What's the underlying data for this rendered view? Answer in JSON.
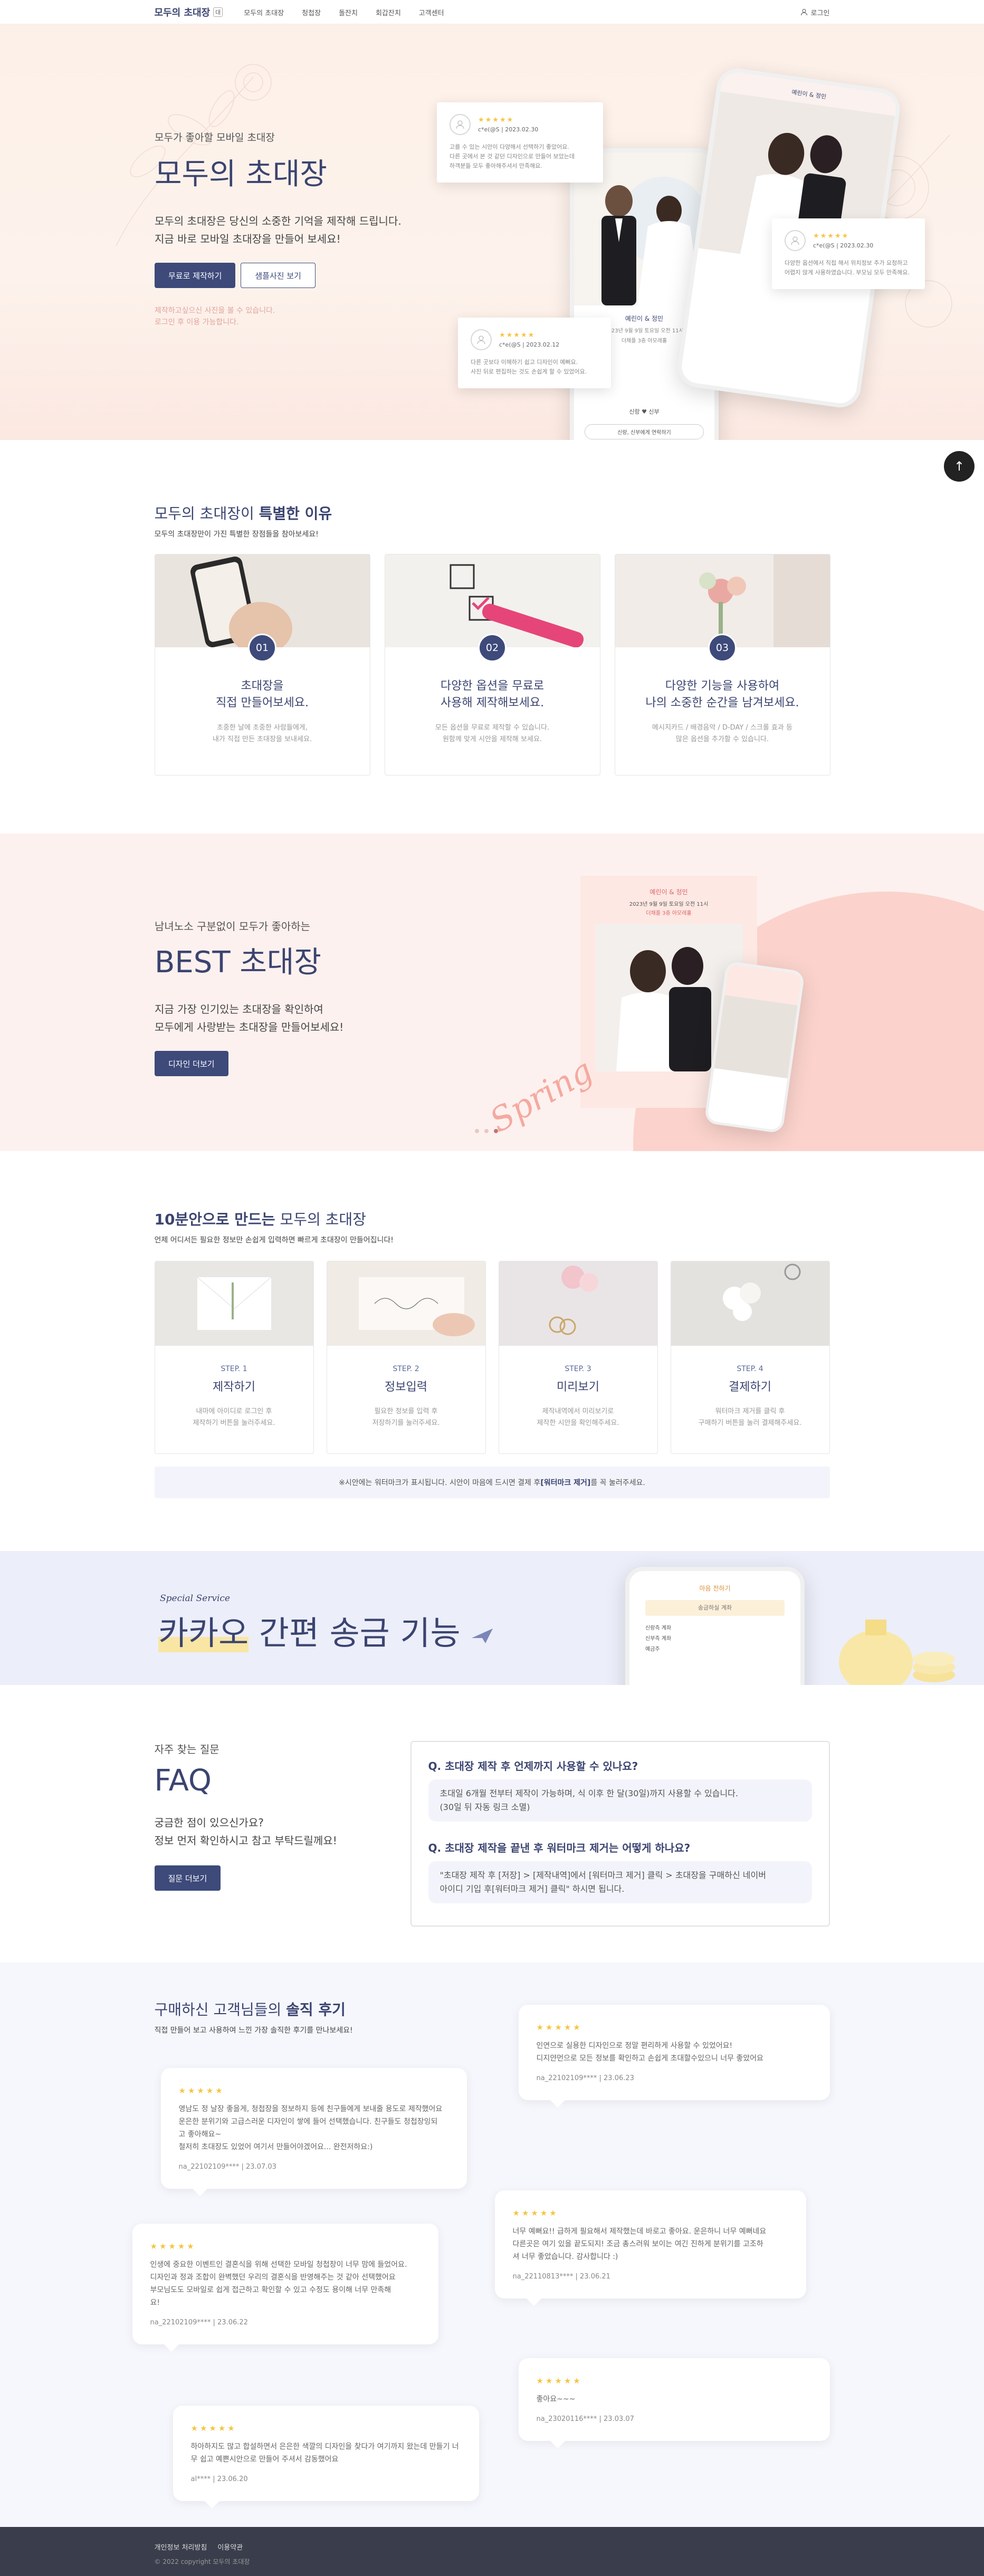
{
  "header": {
    "logo": "모두의 초대장",
    "logo_badge": "대",
    "nav": [
      "모두의 초대장",
      "청첩장",
      "돌잔치",
      "회갑잔치",
      "고객센터"
    ],
    "login": "로그인"
  },
  "hero": {
    "sub": "모두가 좋아할 모바일 초대장",
    "title": "모두의 초대장",
    "desc": "모두의 초대장은 당신의 소중한 기억을 제작해 드립니다.\n지금 바로 모바일 초대장을 만들어 보세요!",
    "btn_primary": "무료로 제작하기",
    "btn_outline": "샘플사진 보기",
    "note": "제작하고싶으신 사진을 볼 수 있습니다.\n로그인 후 이용 가능합니다.",
    "reviews": [
      {
        "stars": "★★★★★",
        "id": "c*e(@S",
        "date": "2023.02.30",
        "text": "고를 수 있는 시안이 다양해서 선택하기 좋았어요.\n다른 곳에서 본 것 같던 디자인으로 만들어 보았는데\n하객분들 모두 좋아해주셔서 만족해요."
      },
      {
        "stars": "★★★★★",
        "id": "c*e(@S",
        "date": "2023.02.30",
        "text": "다양한 옵션에서 직접 해서 위치정보 추가 요청하고\n어렵지 않게 사용하였습니다. 부모님 모두 만족해요."
      },
      {
        "stars": "★★★★★",
        "id": "c*e(@S",
        "date": "2023.02.12",
        "text": "다른 곳보다 이해하기 쉽고 디자인이 예뻐요.\n사진 뒤로 편집하는 것도 손쉽게 할 수 있었어요."
      }
    ],
    "phone_text": {
      "names": "예린이 & 정민",
      "date": "2023년 9월 9일 토요일 오전 11시",
      "place": "더채플 3층 아모레홀",
      "btn": "신랑, 신부에게 연락하기",
      "couple": "신랑 ♥ 신부"
    }
  },
  "top_button": "↑",
  "reasons": {
    "title_plain": "모두의 초대장이 ",
    "title_bold": "특별한 이유",
    "subtitle": "모두의 초대장만이 가진 특별한 장점들을 참아보세요!",
    "cards": [
      {
        "num": "01",
        "title": "초대장을\n직접 만들어보세요.",
        "desc": "초중한 날에 초중한 사람들에게,\n내가 직접 만든 초대장을 보내세요."
      },
      {
        "num": "02",
        "title": "다양한 옵션을 무료로\n사용해 제작해보세요.",
        "desc": "모든 옵션을 무료로 제작할 수 있습니다.\n원함께 맞게 시안을 제작해 보세요."
      },
      {
        "num": "03",
        "title": "다양한 기능을 사용하여\n나의 소중한 순간을 남겨보세요.",
        "desc": "메시지카드 / 배경음악 / D-DAY / 스크롤 효과 등\n많은 옵션을 추가할 수 있습니다."
      }
    ]
  },
  "best": {
    "sub": "남녀노소 구분없이 모두가 좋아하는",
    "title": "BEST 초대장",
    "desc": "지금 가장 인기있는 초대장을 확인하여\n모두에게 사랑받는 초대장을 만들어보세요!",
    "btn": "디자인 더보기",
    "card_names": "예린이 & 정민",
    "card_date": "2023년 9월 9일 토요일 오전 11시",
    "card_place": "더채플 3층 아모레홀",
    "script": "Spring"
  },
  "steps": {
    "title_bold": "10분안으로 만드는",
    "title_plain": " 모두의 초대장",
    "subtitle": "언제 어디서든 필요한 정보만 손쉽게 입력하면 빠르게 초대장이 만들어집니다!",
    "cards": [
      {
        "label": "STEP. 1",
        "title": "제작하기",
        "desc": "내마에 아이디로 로그인 후\n제작하기 버튼을 눌러주세요."
      },
      {
        "label": "STEP. 2",
        "title": "정보입력",
        "desc": "필요한 정보를 입력 후\n저장하기를 눌러주세요."
      },
      {
        "label": "STEP. 3",
        "title": "미리보기",
        "desc": "제작내역에서 미리보기로\n제작한 시안을 확인해주세요."
      },
      {
        "label": "STEP. 4",
        "title": "결제하기",
        "desc": "워터마크 제거를 클릭 후\n구매하기 버튼을 눌러 결제해주세요."
      }
    ],
    "notice_plain": "※시안에는 워터마크가 표시됩니다. 시안이 마음에 드시면 결제 후 ",
    "notice_bold": "[워터마크 제거]",
    "notice_end": "를 꼭 눌러주세요."
  },
  "kakao": {
    "special": "Special Service",
    "title_hl": "카카오",
    "title_rest": " 간편 송금 기능",
    "phone_title": "마음 전하기",
    "phone_btn": "송금하실 계좌",
    "phone_rows": [
      "신랑측 계좌",
      "신부측 계좌",
      "예금주"
    ]
  },
  "faq": {
    "sub": "자주 찾는 질문",
    "title": "FAQ",
    "desc": "궁금한 점이 있으신가요?\n정보 먼저 확인하시고 참고 부탁드릴께요!",
    "btn": "질문 더보기",
    "items": [
      {
        "q": "Q. 초대장 제작 후 언제까지 사용할 수 있나요?",
        "a": "초대일 6개월 전부터 제작이 가능하며, 식 이후 한 달(30일)까지 사용할 수 있습니다.\n(30일 뒤 자동 링크 소멸)"
      },
      {
        "q": "Q. 초대장 제작을 끝낸 후 워터마크 제거는 어떻게 하나요?",
        "a": "\"초대장 제작 후 [저장] > [제작내역]에서 [워터마크 제거] 클릭 > 초대장을 구매하신 네이버\n아이디 기입 후[워터마크 제거] 클릭\" 하시면 됩니다."
      }
    ]
  },
  "reviews": {
    "title_plain": "구매하신 고객님들의 ",
    "title_bold": "솔직 후기",
    "subtitle": "직접 만들어 보고 사용하여 느낀 가장 솔직한 후기를 만나보세요!",
    "items": [
      {
        "stars": "★★★★★",
        "text": "영남도 정 날장 좋을게, 청첩장을 정보하지 등에 친구들에게 보내줄 용도로 제작했어요\n운은한 분위기와 고급스러운 디자인이 쌓에 들어 선택했습니다. 친구들도 청첩장잉되\n고 좋아해요~\n철저히 초대장도 있었어 여기서 만들어야겠어요... 완전저하요:)",
        "meta": "na_22102109****  |  23.07.03"
      },
      {
        "stars": "★★★★★",
        "text": "인연으로 실용한 디자인으로 정말 편리하게 사용할 수 있었어요!\n디지얀먼으로 모든 정보를 확인하고 손쉽게 초대할수있으니 너무 좋았어요",
        "meta": "na_22102109****  |  23.06.23"
      },
      {
        "stars": "★★★★★",
        "text": "인생에 중요한 이벤트인 결혼식을 위해 선택한 모바일 청첩장이 너무 맘에 들었어요.\n디자인과 정과 조합이 완벽했던 우리의 결혼식을 반영해주는 것 같아 선택했어요\n부모님도도 모바일로 쉽게 접근하고 확인할 수 있고 수정도 용이해 너무 만족해\n요!",
        "meta": "na_22102109****  |  23.06.22"
      },
      {
        "stars": "★★★★★",
        "text": "너무 예뻐요!! 급하게 필요해서 제작했는데 바로고 좋아요. 운은하니 너무 예뻐네요\n다른곳은 여기 있을 끝도되지! 조금 총스러워 보이는 여긴 진하게 분위기를 고조하\n셔 너무 좋았습니다. 감사합니다 :)",
        "meta": "na_22110813****  |  23.06.21"
      },
      {
        "stars": "★★★★★",
        "text": "하아하지도 많고 합설하면서 은은한 색깔의 디자인을 찾다가 여기까지 왔는데 만들기 너\n무 쉽고 예쁜시안으로 만들어 주셔서 감동했어요",
        "meta": "al****  |  23.06.20"
      },
      {
        "stars": "★★★★★",
        "text": "좋아요~~~",
        "meta": "na_23020116****  |  23.03.07"
      }
    ]
  },
  "footer": {
    "links": [
      "개인정보 처리방침",
      "이용약관"
    ],
    "copy": "© 2022 copyright 모두의 초대장"
  },
  "colors": {
    "accent": "#3d4a7a",
    "hero_bg": "#fdf0e8",
    "best_bg": "#fdf1ef",
    "kakao_bg": "#eceef9",
    "star": "#f4c542"
  }
}
